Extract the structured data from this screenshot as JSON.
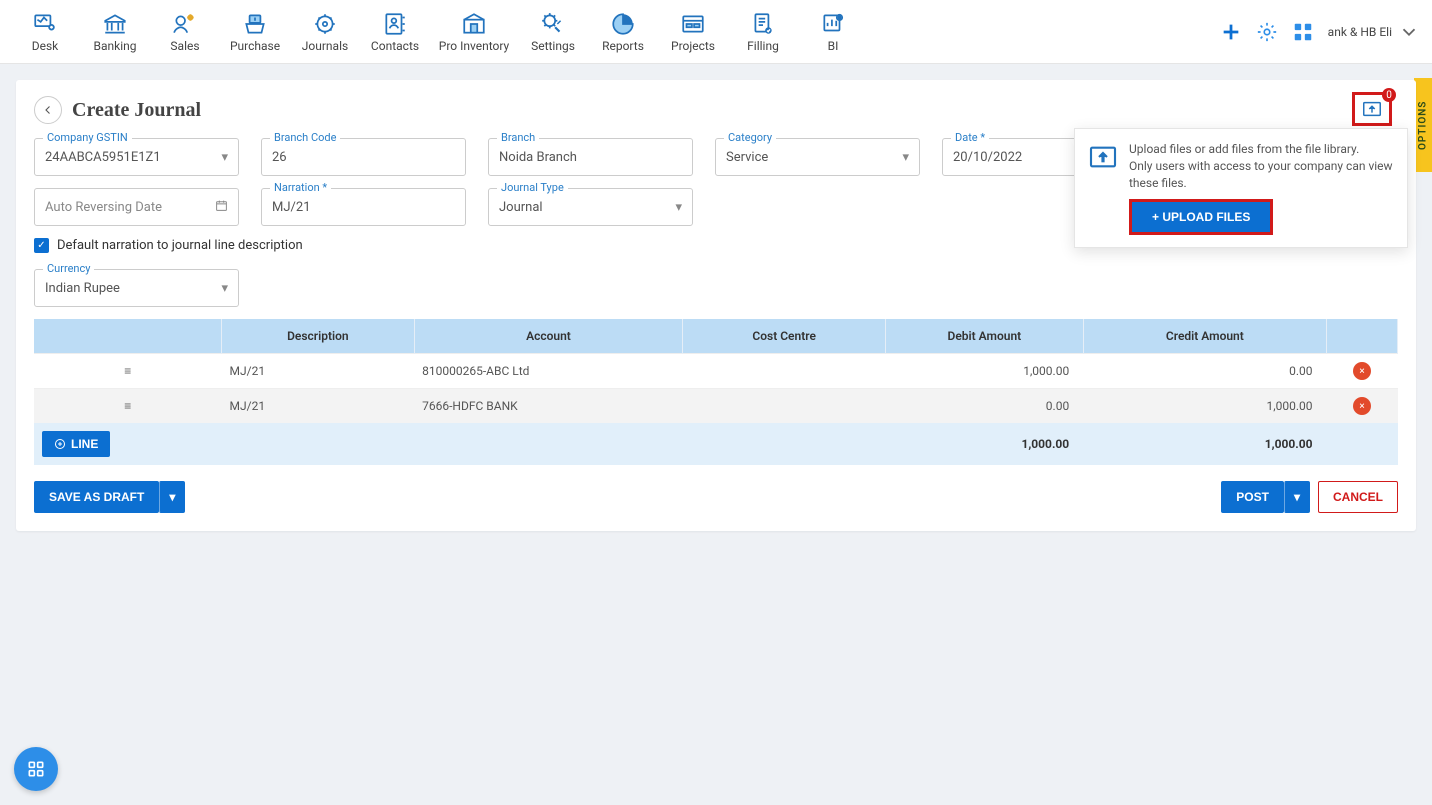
{
  "topnav": {
    "items": [
      {
        "label": "Desk"
      },
      {
        "label": "Banking"
      },
      {
        "label": "Sales"
      },
      {
        "label": "Purchase"
      },
      {
        "label": "Journals"
      },
      {
        "label": "Contacts"
      },
      {
        "label": "Pro Inventory"
      },
      {
        "label": "Settings"
      },
      {
        "label": "Reports"
      },
      {
        "label": "Projects"
      },
      {
        "label": "Filling"
      },
      {
        "label": "BI"
      }
    ],
    "account_text": "ank & HB Eli"
  },
  "page": {
    "title": "Create Journal"
  },
  "form": {
    "company_gstin": {
      "label": "Company GSTIN",
      "value": "24AABCA5951E1Z1"
    },
    "branch_code": {
      "label": "Branch Code",
      "value": "26"
    },
    "branch": {
      "label": "Branch",
      "value": "Noida Branch"
    },
    "category": {
      "label": "Category",
      "value": "Service"
    },
    "date": {
      "label": "Date *",
      "value": "20/10/2022"
    },
    "auto_rev": {
      "placeholder": "Auto Reversing Date"
    },
    "narration": {
      "label": "Narration *",
      "value": "MJ/21"
    },
    "journal_type": {
      "label": "Journal Type",
      "value": "Journal"
    },
    "default_narration_checkbox": "Default narration to journal line description",
    "currency": {
      "label": "Currency",
      "value": "Indian Rupee"
    }
  },
  "upload": {
    "badge": "0",
    "line1": "Upload files or add files from the file library.",
    "line2": "Only users with access to your company can view these files.",
    "button": "+ UPLOAD FILES"
  },
  "table": {
    "headers": {
      "description": "Description",
      "account": "Account",
      "cost_centre": "Cost Centre",
      "debit": "Debit Amount",
      "credit": "Credit Amount"
    },
    "rows": [
      {
        "description": "MJ/21",
        "account": "810000265-ABC Ltd",
        "cost_centre": "",
        "debit": "1,000.00",
        "credit": "0.00"
      },
      {
        "description": "MJ/21",
        "account": "7666-HDFC BANK",
        "cost_centre": "",
        "debit": "0.00",
        "credit": "1,000.00"
      }
    ],
    "add_line": "LINE",
    "totals": {
      "debit": "1,000.00",
      "credit": "1,000.00"
    }
  },
  "buttons": {
    "save_draft": "SAVE AS DRAFT",
    "post": "POST",
    "cancel": "CANCEL"
  },
  "options_tab": "OPTIONS"
}
